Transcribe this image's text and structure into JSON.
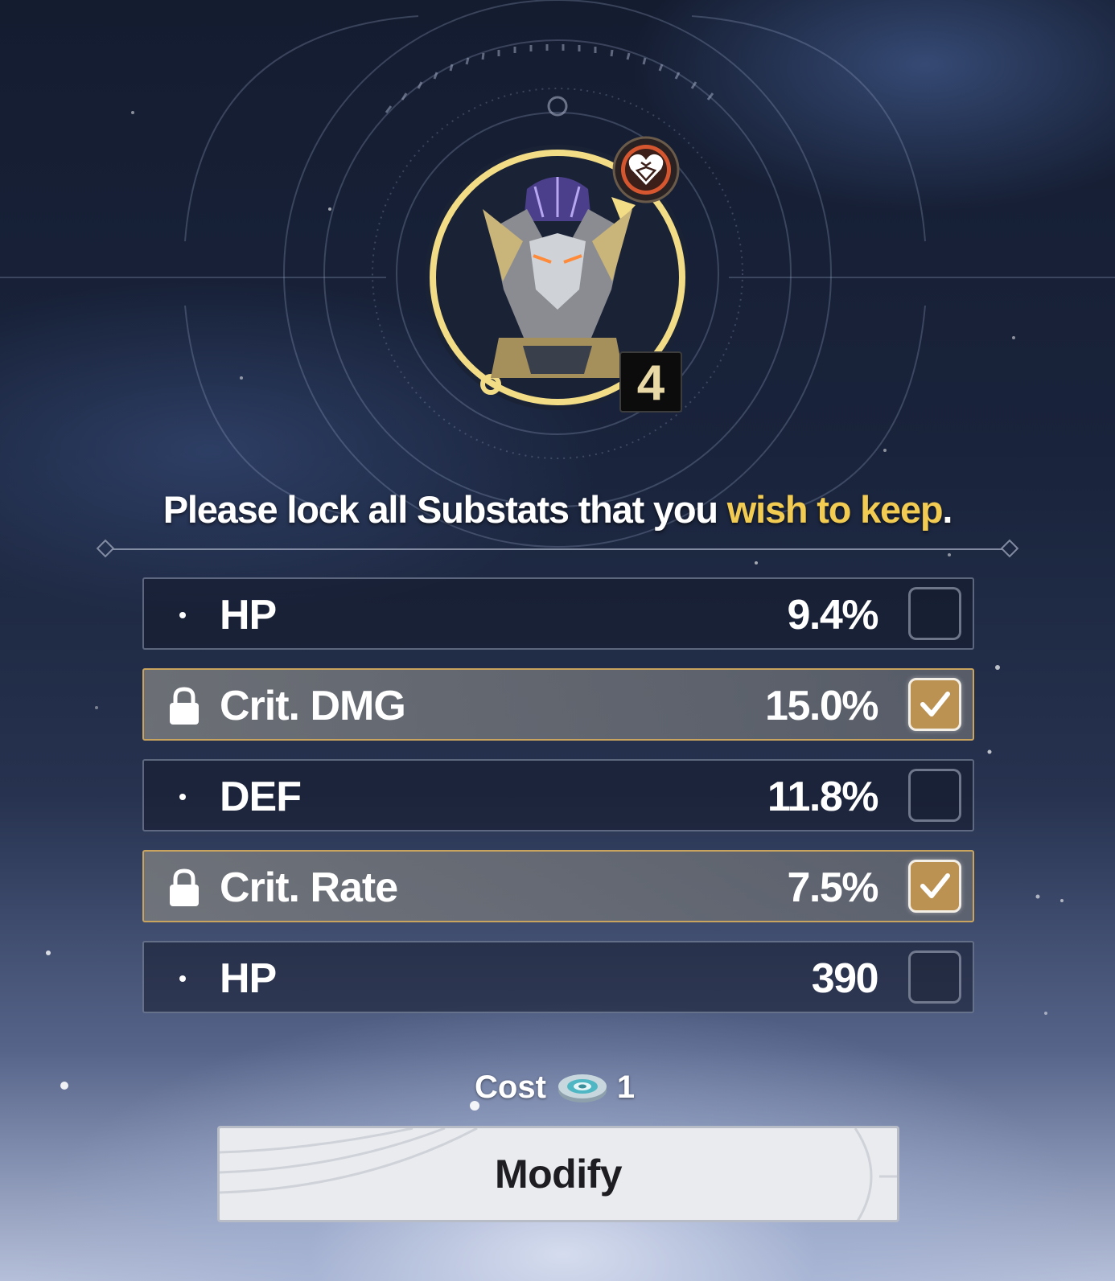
{
  "item": {
    "level": "4",
    "badge_icon": "heart-emblem-icon"
  },
  "prompt": {
    "text_before": "Please lock all Substats that you ",
    "text_highlight": "wish to keep",
    "text_after": "."
  },
  "substats": [
    {
      "name": "HP",
      "value": "9.4%",
      "locked": false
    },
    {
      "name": "Crit. DMG",
      "value": "15.0%",
      "locked": true
    },
    {
      "name": "DEF",
      "value": "11.8%",
      "locked": false
    },
    {
      "name": "Crit. Rate",
      "value": "7.5%",
      "locked": true
    },
    {
      "name": "HP",
      "value": "390",
      "locked": false
    }
  ],
  "cost": {
    "label": "Cost",
    "amount": "1",
    "icon": "modulator-icon"
  },
  "modify_button": {
    "label": "Modify"
  },
  "colors": {
    "accent_gold": "#f2cb52",
    "checked_fill": "#bb9252",
    "lock_border": "#c9a45f"
  }
}
